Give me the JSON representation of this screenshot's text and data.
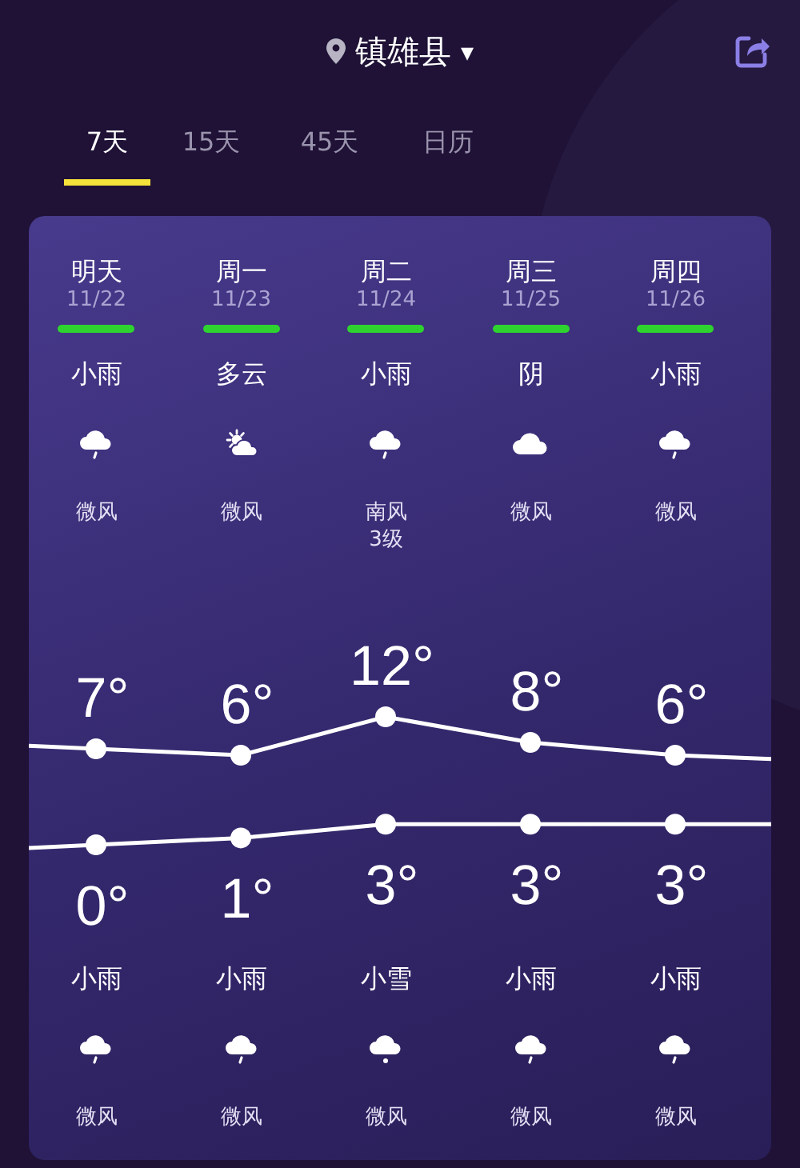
{
  "header": {
    "location": "镇雄县",
    "dropdown": "▾"
  },
  "tabs": [
    {
      "label": "7天",
      "selected": true
    },
    {
      "label": "15天",
      "selected": false
    },
    {
      "label": "45天",
      "selected": false
    },
    {
      "label": "日历",
      "selected": false
    }
  ],
  "days": [
    {
      "name": "明天",
      "date": "11/22",
      "color": "#2fd32f",
      "day": {
        "weather": "小雨",
        "kind": "rain",
        "wind": "微风"
      },
      "high": "7°",
      "low": "0°",
      "night": {
        "weather": "小雨",
        "kind": "rain",
        "wind": "微风"
      }
    },
    {
      "name": "周一",
      "date": "11/23",
      "color": "#2fd32f",
      "day": {
        "weather": "多云",
        "kind": "partly_cloudy",
        "wind": "微风"
      },
      "high": "6°",
      "low": "1°",
      "night": {
        "weather": "小雨",
        "kind": "rain",
        "wind": "微风"
      }
    },
    {
      "name": "周二",
      "date": "11/24",
      "color": "#2fd32f",
      "day": {
        "weather": "小雨",
        "kind": "rain",
        "wind": "南风\n3级"
      },
      "high": "12°",
      "low": "3°",
      "night": {
        "weather": "小雪",
        "kind": "snow",
        "wind": "微风"
      }
    },
    {
      "name": "周三",
      "date": "11/25",
      "color": "#2fd32f",
      "day": {
        "weather": "阴",
        "kind": "cloudy",
        "wind": "微风"
      },
      "high": "8°",
      "low": "3°",
      "night": {
        "weather": "小雨",
        "kind": "rain",
        "wind": "微风"
      }
    },
    {
      "name": "周四",
      "date": "11/26",
      "color": "#2fd32f",
      "day": {
        "weather": "小雨",
        "kind": "rain",
        "wind": "微风"
      },
      "high": "6°",
      "low": "3°",
      "night": {
        "weather": "小雨",
        "kind": "rain",
        "wind": "微风"
      }
    }
  ]
}
